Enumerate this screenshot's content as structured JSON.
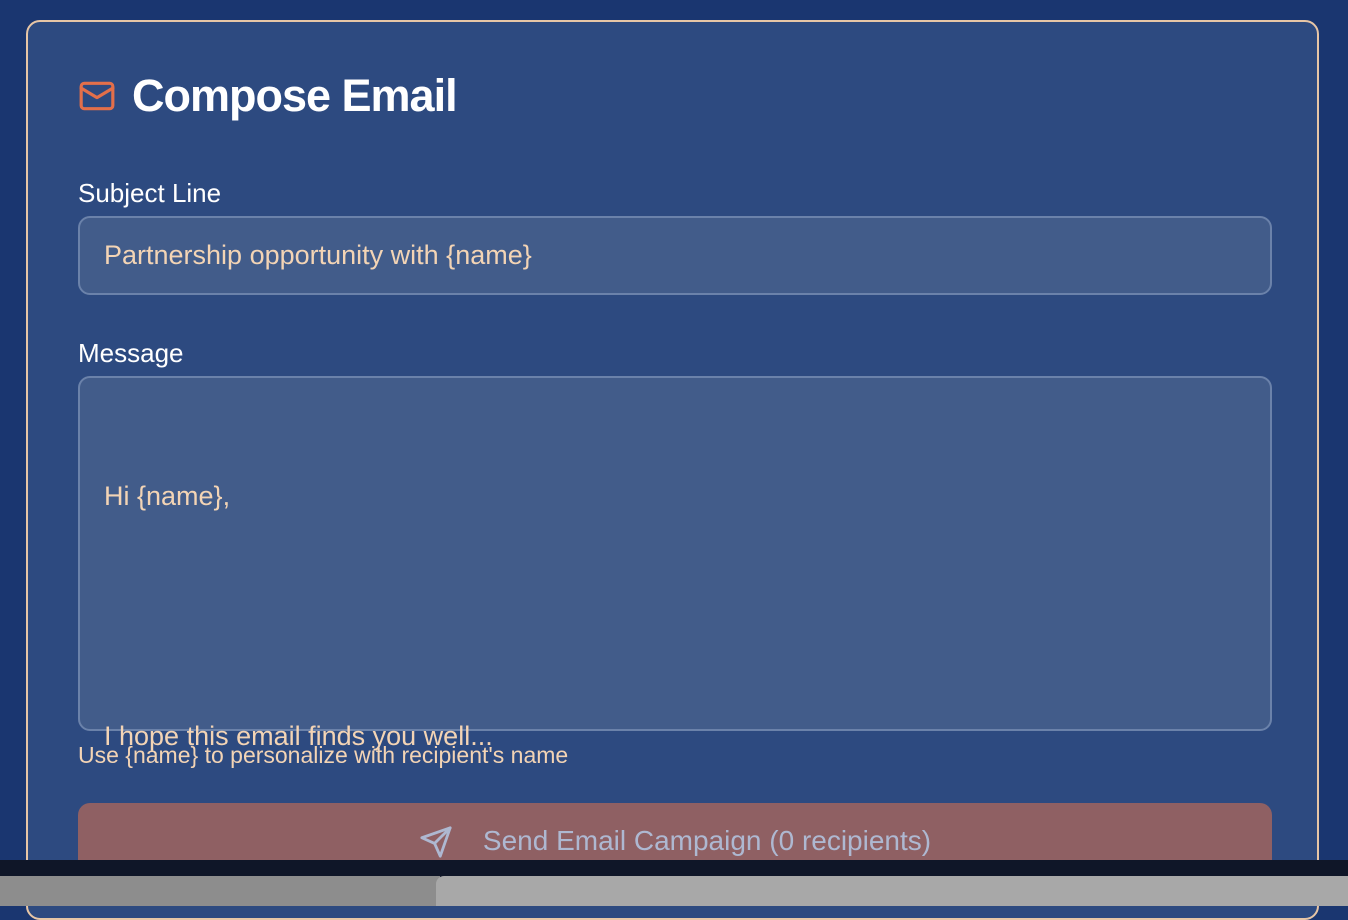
{
  "compose": {
    "title": "Compose Email",
    "subject_label": "Subject Line",
    "subject_value": "Partnership opportunity with {name}",
    "message_label": "Message",
    "message_lines": [
      "Hi {name},",
      "",
      "I hope this email finds you well..."
    ],
    "hint": "Use {name} to personalize with recipient's name",
    "send_label": "Send Email Campaign (0 recipients)"
  },
  "icons": {
    "title_icon": "mail-icon",
    "send_icon": "send-icon"
  },
  "colors": {
    "background": "#1a3670",
    "card": "#2d4a80",
    "card_border": "#e7c6a6",
    "accent": "#e36f4a",
    "field_bg": "#425c8a",
    "field_text": "#f3d4b5",
    "button_bg": "#8f6063",
    "button_text": "#aeb8d1"
  }
}
